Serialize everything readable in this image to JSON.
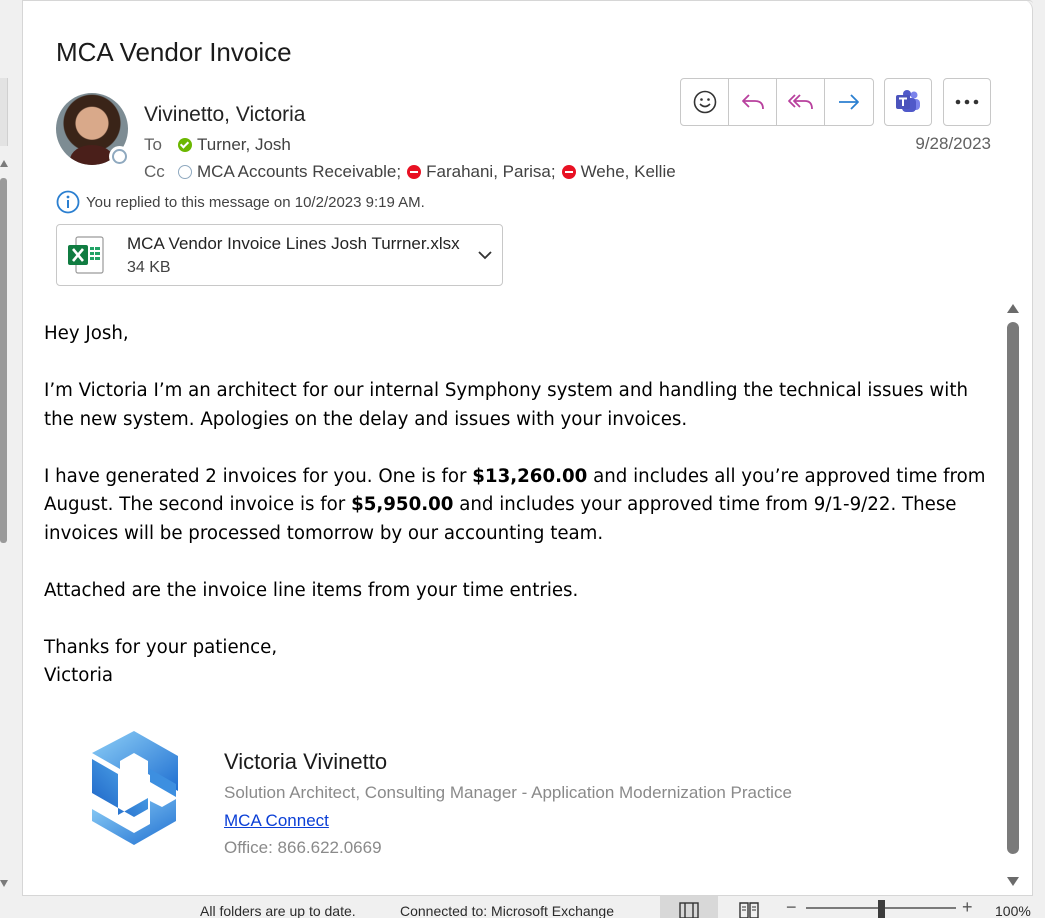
{
  "message": {
    "subject": "MCA Vendor Invoice",
    "sender": "Vivinetto, Victoria",
    "to_label": "To",
    "cc_label": "Cc",
    "to": [
      {
        "name": "Turner, Josh",
        "presence": "available"
      }
    ],
    "cc": [
      {
        "name": "MCA Accounts Receivable;",
        "presence": "offline"
      },
      {
        "name": "Farahani, Parisa;",
        "presence": "busy"
      },
      {
        "name": "Wehe, Kellie",
        "presence": "busy"
      }
    ],
    "date": "9/28/2023",
    "info": "You replied to this message on 10/2/2023 9:19 AM."
  },
  "actions": {
    "emoji": "smiley-icon",
    "reply": "reply-icon",
    "reply_all": "reply-all-icon",
    "forward": "forward-icon",
    "teams": "teams-icon",
    "more": "more-icon"
  },
  "attachment": {
    "name": "MCA Vendor Invoice Lines Josh Turrner.xlsx",
    "size": "34 KB",
    "icon": "excel-icon"
  },
  "body": {
    "greeting": "Hey Josh,",
    "p1": "I’m Victoria I’m an architect for our internal Symphony system and handling the technical issues with the new system. Apologies on the delay and issues with your invoices.",
    "p2_a": "I have generated 2 invoices for you. One is for ",
    "p2_amount1": "$13,260.00",
    "p2_b": " and includes all you’re approved time from August. The second invoice is for ",
    "p2_amount2": "$5,950.00",
    "p2_c": " and includes your approved time from 9/1-9/22. These invoices will be processed tomorrow by our accounting team.",
    "p3": "Attached are the invoice line items from your time entries.",
    "closing": "Thanks for your patience,",
    "closing_name": "Victoria"
  },
  "signature": {
    "name": "Victoria Vivinetto",
    "title": "Solution Architect, Consulting Manager - Application Modernization Practice",
    "link": "MCA Connect",
    "office": "Office: 866.622.0669"
  },
  "status_bar": {
    "sync": "All folders are up to date.",
    "connection": "Connected to: Microsoft Exchange",
    "zoom": "100%",
    "zoom_level_percent": 100
  },
  "colors": {
    "accent_reply": "#b8409d",
    "accent_forward": "#2b7fd0",
    "available": "#6bb700",
    "busy": "#e81123",
    "link": "#0b3fd6"
  }
}
